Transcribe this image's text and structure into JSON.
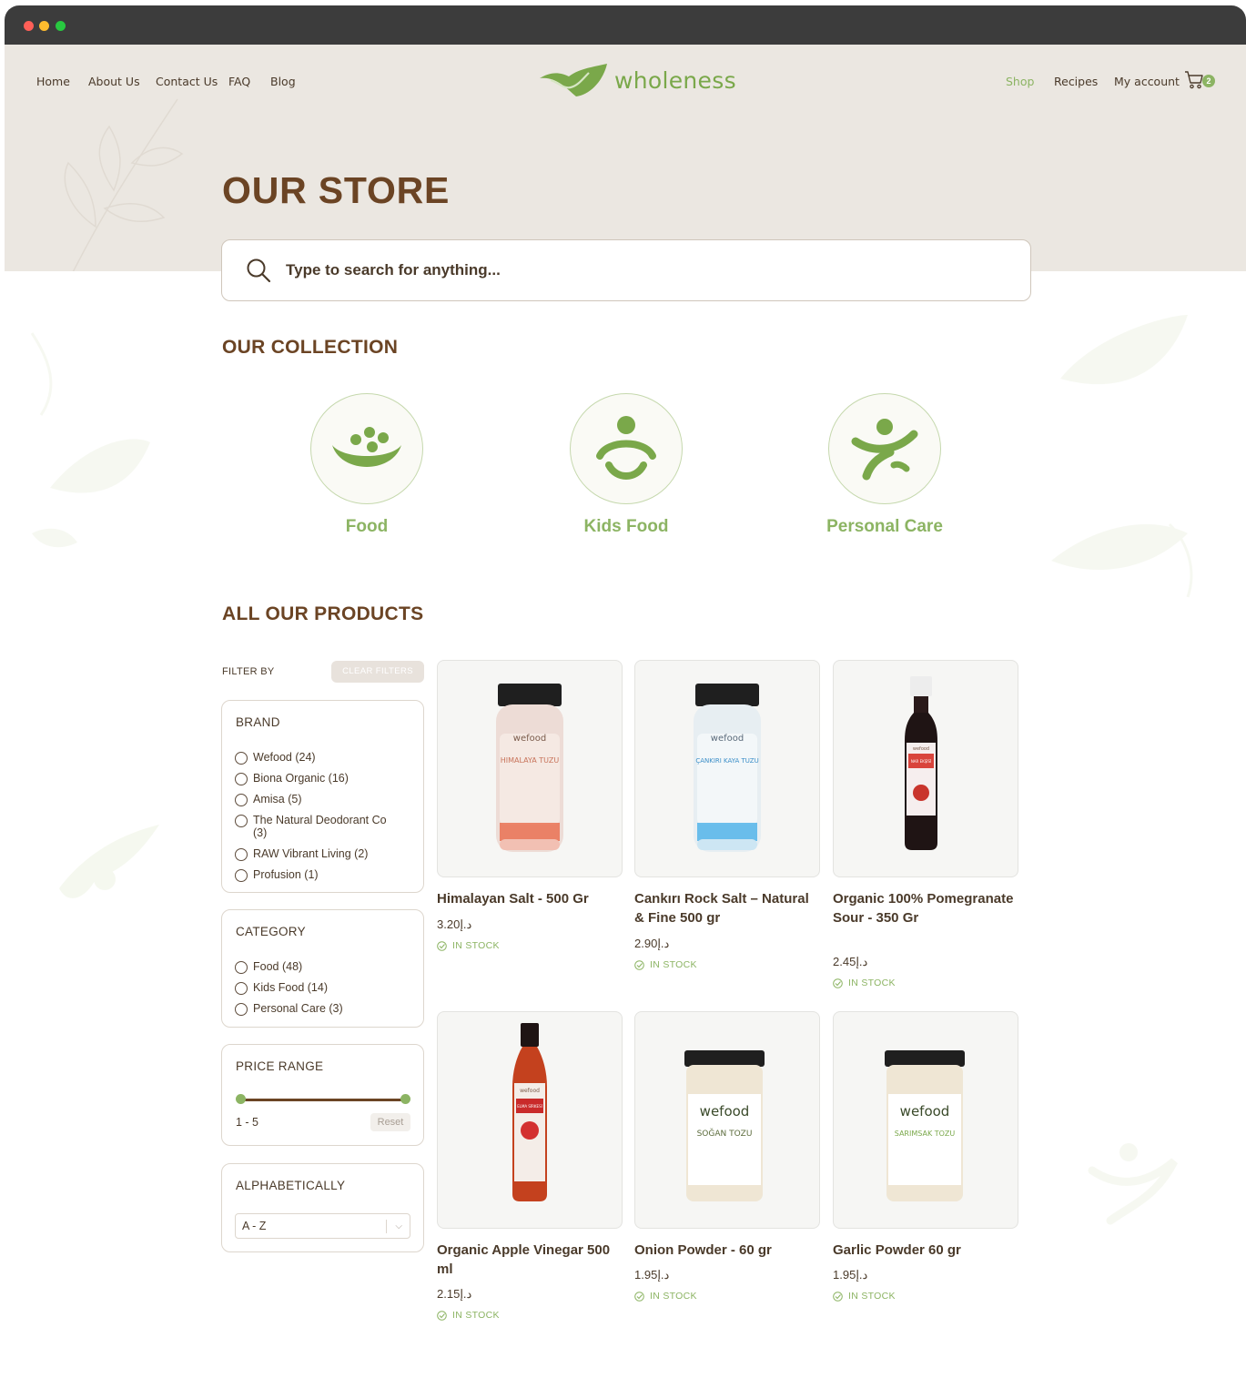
{
  "nav": {
    "left": [
      "Home",
      "About Us",
      "Contact Us",
      "FAQ",
      "Blog"
    ],
    "right": [
      "Shop",
      "Recipes",
      "My account"
    ],
    "cart_count": "2"
  },
  "brand": {
    "name": "wholeness",
    "color": "#7aa84a"
  },
  "hero": {
    "title": "OUR STORE"
  },
  "search": {
    "placeholder": "Type to search for anything..."
  },
  "collection": {
    "title": "OUR COLLECTION",
    "items": [
      {
        "label": "Food",
        "icon": "food-icon"
      },
      {
        "label": "Kids Food",
        "icon": "kids-icon"
      },
      {
        "label": "Personal Care",
        "icon": "personal-care-icon"
      }
    ]
  },
  "products_section": {
    "title": "ALL OUR PRODUCTS"
  },
  "filters": {
    "filter_by": "FILTER BY",
    "clear": "CLEAR FILTERS",
    "brand": {
      "title": "BRAND",
      "options": [
        "Wefood (24)",
        "Biona Organic (16)",
        "Amisa (5)",
        "The Natural Deodorant Co (3)",
        "RAW Vibrant Living (2)",
        "Profusion (1)"
      ]
    },
    "category": {
      "title": "CATEGORY",
      "options": [
        "Food (48)",
        "Kids Food (14)",
        "Personal Care (3)"
      ]
    },
    "price": {
      "title": "PRICE RANGE",
      "range": "1 - 5",
      "reset": "Reset",
      "min": 1,
      "max": 5
    },
    "alpha": {
      "title": "ALPHABETICALLY",
      "selected": "A - Z"
    }
  },
  "products": [
    {
      "name": "Himalayan Salt - 500 Gr",
      "price": "3.20د.إ",
      "stock": "IN STOCK"
    },
    {
      "name": "Cankırı Rock Salt – Natural & Fine 500 gr",
      "price": "2.90د.إ",
      "stock": "IN STOCK"
    },
    {
      "name": "Organic 100% Pomegranate Sour - 350 Gr",
      "price": "2.45د.إ",
      "stock": "IN STOCK"
    },
    {
      "name": "Organic Apple Vinegar 500 ml",
      "price": "2.15د.إ",
      "stock": "IN STOCK"
    },
    {
      "name": "Onion Powder - 60 gr",
      "price": "1.95د.إ",
      "stock": "IN STOCK"
    },
    {
      "name": "Garlic Powder 60 gr",
      "price": "1.95د.إ",
      "stock": "IN STOCK"
    }
  ],
  "product_labels": {
    "jar_brand": "wefood",
    "himalaya": "HIMALAYA TUZU",
    "cankiri": "ÇANKIRI KAYA TUZU",
    "nar": "NAR EKŞİSİ",
    "elma": "ELMA SİRKESİ",
    "sogan": "SOĞAN TOZU",
    "sarimsak": "SARIMSAK TOZU"
  }
}
